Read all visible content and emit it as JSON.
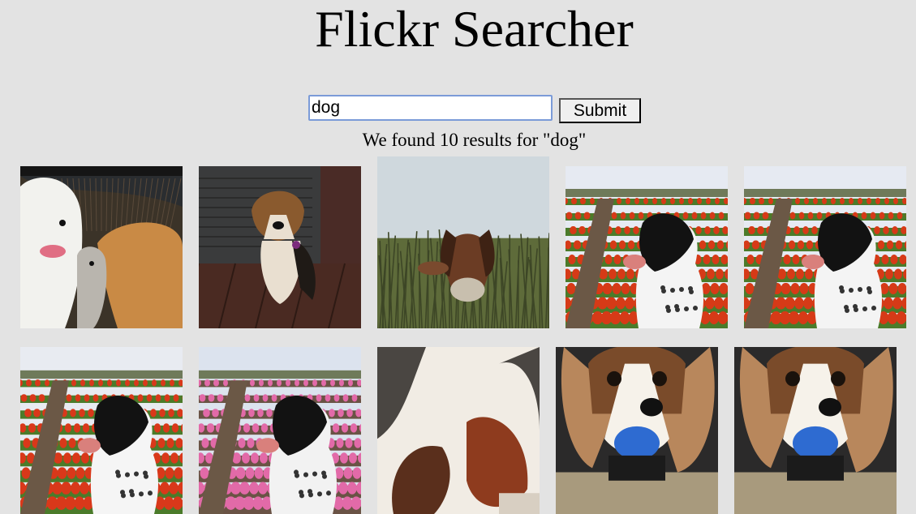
{
  "header": {
    "title": "Flickr Searcher"
  },
  "search": {
    "value": "dog",
    "submit_label": "Submit"
  },
  "results": {
    "summary": "We found 10 results for \"dog\"",
    "photos": [
      {
        "subject": "dogs-group-white-golden",
        "colors": {
          "sky": "#2a2d30",
          "ground": "#3b3328",
          "accent": "#f2f2ee",
          "dog2": "#c98a45",
          "dog3": "#b9b5ae"
        }
      },
      {
        "subject": "beagle-puppy-tile-floor",
        "colors": {
          "sky": "#3a3b3c",
          "ground": "#4a2a22",
          "accent": "#e9dfd0",
          "dog2": "#8a5a2e",
          "dog3": "#1f1a16"
        }
      },
      {
        "subject": "hound-in-grass",
        "colors": {
          "sky": "#cfd8dd",
          "ground": "#5e6b3a",
          "accent": "#6b3c24",
          "dog2": "#c8bfae",
          "dog3": "#3d4626"
        }
      },
      {
        "subject": "spaniel-tulip-field",
        "colors": {
          "sky": "#e6eaf2",
          "ground": "#d63a17",
          "accent": "#121212",
          "dog2": "#f4f4f4",
          "dog3": "#4b7b2a"
        }
      },
      {
        "subject": "spaniel-tulip-field-2",
        "colors": {
          "sky": "#e6eaf2",
          "ground": "#d63a17",
          "accent": "#121212",
          "dog2": "#f4f4f4",
          "dog3": "#4b7b2a"
        }
      },
      {
        "subject": "spotted-dog-tulips",
        "colors": {
          "sky": "#e8ebf1",
          "ground": "#d9381a",
          "accent": "#121212",
          "dog2": "#f5f5f5",
          "dog3": "#4b7b2a"
        }
      },
      {
        "subject": "spotted-dog-pink-tulips",
        "colors": {
          "sky": "#dce3ee",
          "ground": "#e26aa8",
          "accent": "#121212",
          "dog2": "#f2f2f2",
          "dog3": "#6a5345"
        }
      },
      {
        "subject": "cavalier-sleeping",
        "colors": {
          "sky": "#4a4642",
          "ground": "#f1ece4",
          "accent": "#8e3b1e",
          "dog2": "#d8cfc2",
          "dog3": "#5a2f1c"
        }
      },
      {
        "subject": "cavalier-with-ball",
        "colors": {
          "sky": "#2b2a2a",
          "ground": "#b8875c",
          "accent": "#f6f2ea",
          "dog2": "#2e6bd1",
          "dog3": "#7a4b2a"
        }
      },
      {
        "subject": "cavalier-with-ball-2",
        "colors": {
          "sky": "#2b2a2a",
          "ground": "#b8875c",
          "accent": "#f6f2ea",
          "dog2": "#2e6bd1",
          "dog3": "#7a4b2a"
        }
      }
    ]
  }
}
